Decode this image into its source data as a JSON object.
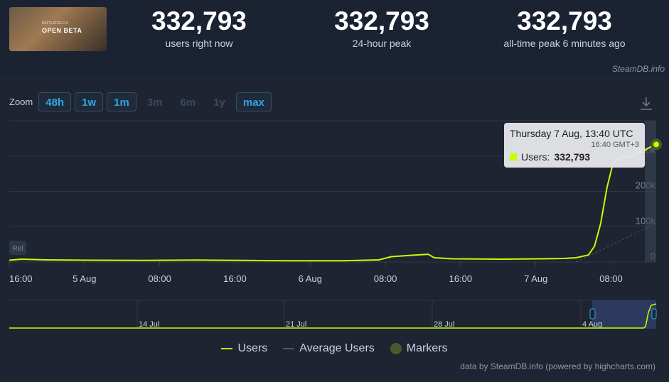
{
  "header": {
    "game_thumb": {
      "title": "OPEN BETA",
      "subtitle": "BATTLEFIELD 6"
    },
    "stats": [
      {
        "value": "332,793",
        "label": "users right now"
      },
      {
        "value": "332,793",
        "label": "24-hour peak"
      },
      {
        "value": "332,793",
        "label": "all-time peak 6 minutes ago"
      }
    ],
    "brand": "SteamDB.info"
  },
  "zoom": {
    "label": "Zoom",
    "buttons": [
      {
        "label": "48h",
        "enabled": true
      },
      {
        "label": "1w",
        "enabled": true
      },
      {
        "label": "1m",
        "enabled": true
      },
      {
        "label": "3m",
        "enabled": false
      },
      {
        "label": "6m",
        "enabled": false
      },
      {
        "label": "1y",
        "enabled": false
      },
      {
        "label": "max",
        "enabled": true
      }
    ]
  },
  "tooltip": {
    "date": "Thursday 7 Aug, 13:40 UTC",
    "local": "16:40 GMT+3",
    "series": "Users:",
    "value": "332,793"
  },
  "legend": [
    {
      "name": "Users",
      "color": "#c6ff00"
    },
    {
      "name": "Average Users",
      "color": "#4a5568"
    },
    {
      "name": "Markers",
      "color": "#4a5a2c"
    }
  ],
  "credit": "data by SteamDB.info (powered by highcharts.com)",
  "colors": {
    "users": "#c6ff00",
    "accent": "#2ea8e6",
    "background": "#1b2333"
  },
  "chart_data": {
    "type": "line",
    "xlabel": "",
    "ylabel": "",
    "x_ticks": [
      "16:00",
      "5 Aug",
      "08:00",
      "16:00",
      "6 Aug",
      "08:00",
      "16:00",
      "7 Aug",
      "08:00"
    ],
    "y_ticks": [
      "0",
      "100k",
      "200k",
      "300k"
    ],
    "ylim": [
      0,
      400000
    ],
    "grid": true,
    "legend_position": "bottom",
    "marker_label": "Rel",
    "navigator_ticks": [
      "14 Jul",
      "21 Jul",
      "28 Jul",
      "4 Aug"
    ],
    "x_unit": "hours since first point",
    "series": [
      {
        "name": "Users",
        "points": [
          [
            0,
            5000
          ],
          [
            2,
            8000
          ],
          [
            6,
            6000
          ],
          [
            14,
            5000
          ],
          [
            22,
            4500
          ],
          [
            30,
            5500
          ],
          [
            38,
            4500
          ],
          [
            46,
            3500
          ],
          [
            54,
            3500
          ],
          [
            60,
            6000
          ],
          [
            62,
            15000
          ],
          [
            66,
            20000
          ],
          [
            68,
            22000
          ],
          [
            69,
            12000
          ],
          [
            72,
            9000
          ],
          [
            80,
            8000
          ],
          [
            86,
            9000
          ],
          [
            90,
            10000
          ],
          [
            92,
            12000
          ],
          [
            94,
            20000
          ],
          [
            95,
            45000
          ],
          [
            96,
            110000
          ],
          [
            97,
            210000
          ],
          [
            98,
            280000
          ],
          [
            99,
            295000
          ],
          [
            101,
            300000
          ],
          [
            103,
            315000
          ],
          [
            104,
            325000
          ],
          [
            105,
            332793
          ]
        ]
      }
    ]
  }
}
